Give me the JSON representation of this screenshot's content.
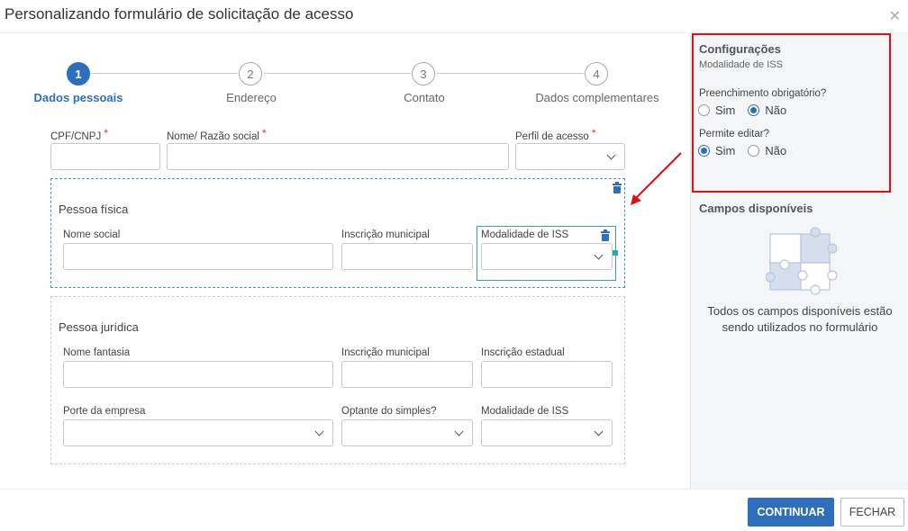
{
  "dialog": {
    "title": "Personalizando formulário de solicitação de acesso"
  },
  "stepper": {
    "steps": [
      {
        "number": "1",
        "label": "Dados pessoais"
      },
      {
        "number": "2",
        "label": "Endereço"
      },
      {
        "number": "3",
        "label": "Contato"
      },
      {
        "number": "4",
        "label": "Dados complementares"
      }
    ]
  },
  "form": {
    "top_fields": {
      "cpf": {
        "label": "CPF/CNPJ",
        "required": "*"
      },
      "nome": {
        "label": "Nome/ Razão social",
        "required": "*"
      },
      "perfil": {
        "label": "Perfil de acesso",
        "required": "*"
      }
    },
    "pessoa_fisica": {
      "title": "Pessoa física",
      "fields": {
        "nome_social": "Nome social",
        "inscricao_municipal": "Inscrição municipal",
        "modalidade_iss": "Modalidade de ISS"
      }
    },
    "pessoa_juridica": {
      "title": "Pessoa jurídica",
      "fields": {
        "nome_fantasia": "Nome fantasia",
        "inscricao_municipal": "Inscrição municipal",
        "inscricao_estadual": "Inscrição estadual",
        "porte_empresa": "Porte da empresa",
        "optante_simples": "Optante do simples?",
        "modalidade_iss": "Modalidade de ISS"
      }
    }
  },
  "config_panel": {
    "title": "Configurações",
    "subtitle": "Modalidade de ISS",
    "required_question": "Preenchimento obrigatório?",
    "editable_question": "Permite editar?",
    "option_yes": "Sim",
    "option_no": "Não",
    "required_value": "Não",
    "editable_value": "Sim"
  },
  "available_fields": {
    "title": "Campos disponíveis",
    "empty_message": "Todos os campos disponíveis estão sendo utilizados no formulário"
  },
  "footer": {
    "continue_label": "CONTINUAR",
    "close_label": "FECHAR"
  },
  "colors": {
    "primary": "#2f6eba",
    "highlight_border": "#e0101a",
    "selection": "#3aa0b8"
  }
}
